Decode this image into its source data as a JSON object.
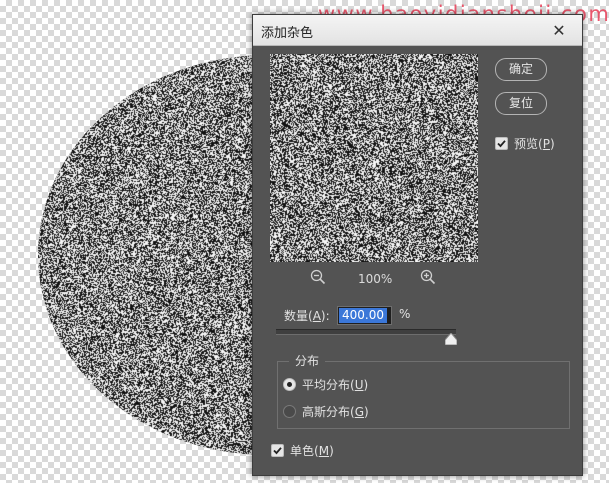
{
  "watermark": "www.haoyidiansheji.com",
  "dialog": {
    "title": "添加杂色",
    "close_icon": "close-icon",
    "ok_label": "确定",
    "reset_label": "复位",
    "preview_label": "预览",
    "preview_key": "P",
    "preview_checked": true,
    "zoom_level": "100%",
    "amount_label": "数量",
    "amount_key": "A",
    "amount_value": "400.00",
    "amount_unit": "%",
    "amount_fraction": 1.0,
    "distribution_title": "分布",
    "uniform_label": "平均分布",
    "uniform_key": "U",
    "uniform_selected": true,
    "gaussian_label": "高斯分布",
    "gaussian_key": "G",
    "monochrome_label": "单色",
    "monochrome_key": "M",
    "monochrome_checked": true
  },
  "colors": {
    "dialog_bg": "#535353",
    "accent_selection": "#3b77d8",
    "watermark": "#e8475f"
  }
}
